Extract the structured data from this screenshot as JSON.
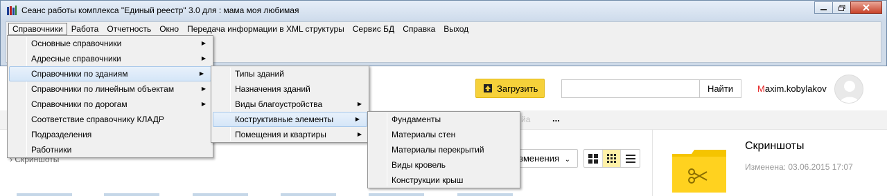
{
  "window": {
    "title": "Сеанс работы комплекса \"Единый реестр\" 3.0 для : мама моя любимая"
  },
  "menubar": {
    "items": [
      "Справочники",
      "Работа",
      "Отчетность",
      "Окно",
      "Передача информации в XML структуры",
      "Сервис БД",
      "Справка",
      "Выход"
    ]
  },
  "menu_main": {
    "items": [
      {
        "label": "Основные справочники",
        "submenu": true
      },
      {
        "label": "Адресные справочники",
        "submenu": true
      },
      {
        "label": "Справочники по зданиям",
        "submenu": true
      },
      {
        "label": "Справочники по линейным объектам",
        "submenu": true
      },
      {
        "label": "Справочники по дорогам",
        "submenu": true
      },
      {
        "label": "Соответствие справочнику КЛАДР",
        "submenu": false
      },
      {
        "label": "Подразделения",
        "submenu": false
      },
      {
        "label": "Работники",
        "submenu": false
      }
    ]
  },
  "menu_buildings": {
    "items": [
      {
        "label": "Типы зданий",
        "submenu": false
      },
      {
        "label": "Назначения зданий",
        "submenu": false
      },
      {
        "label": "Виды благоустройства",
        "submenu": true
      },
      {
        "label": "Коструктивные элементы",
        "submenu": true
      },
      {
        "label": "Помещения и квартиры",
        "submenu": true
      }
    ]
  },
  "menu_elements": {
    "items": [
      {
        "label": "Фундаменты"
      },
      {
        "label": "Материалы стен"
      },
      {
        "label": "Материалы перекрытий"
      },
      {
        "label": "Виды кровель"
      },
      {
        "label": "Конструкции крыш"
      }
    ]
  },
  "web": {
    "upload_label": "Загрузить",
    "search_button": "Найти",
    "user_first": "M",
    "user_rest": "axim.kobylakov",
    "nav_more": "...",
    "nav_faded": "йа",
    "sort_label": "зменения",
    "breadcrumb": "› Скриншоты",
    "folder_title": "Скриншоты",
    "folder_date": "Изменена: 03.06.2015 17:07"
  },
  "colors": {
    "accent_yellow": "#f6d13a",
    "folder_yellow": "#f5c400",
    "user_red": "#e62222",
    "menu_highlight": "#d5e6f8"
  }
}
